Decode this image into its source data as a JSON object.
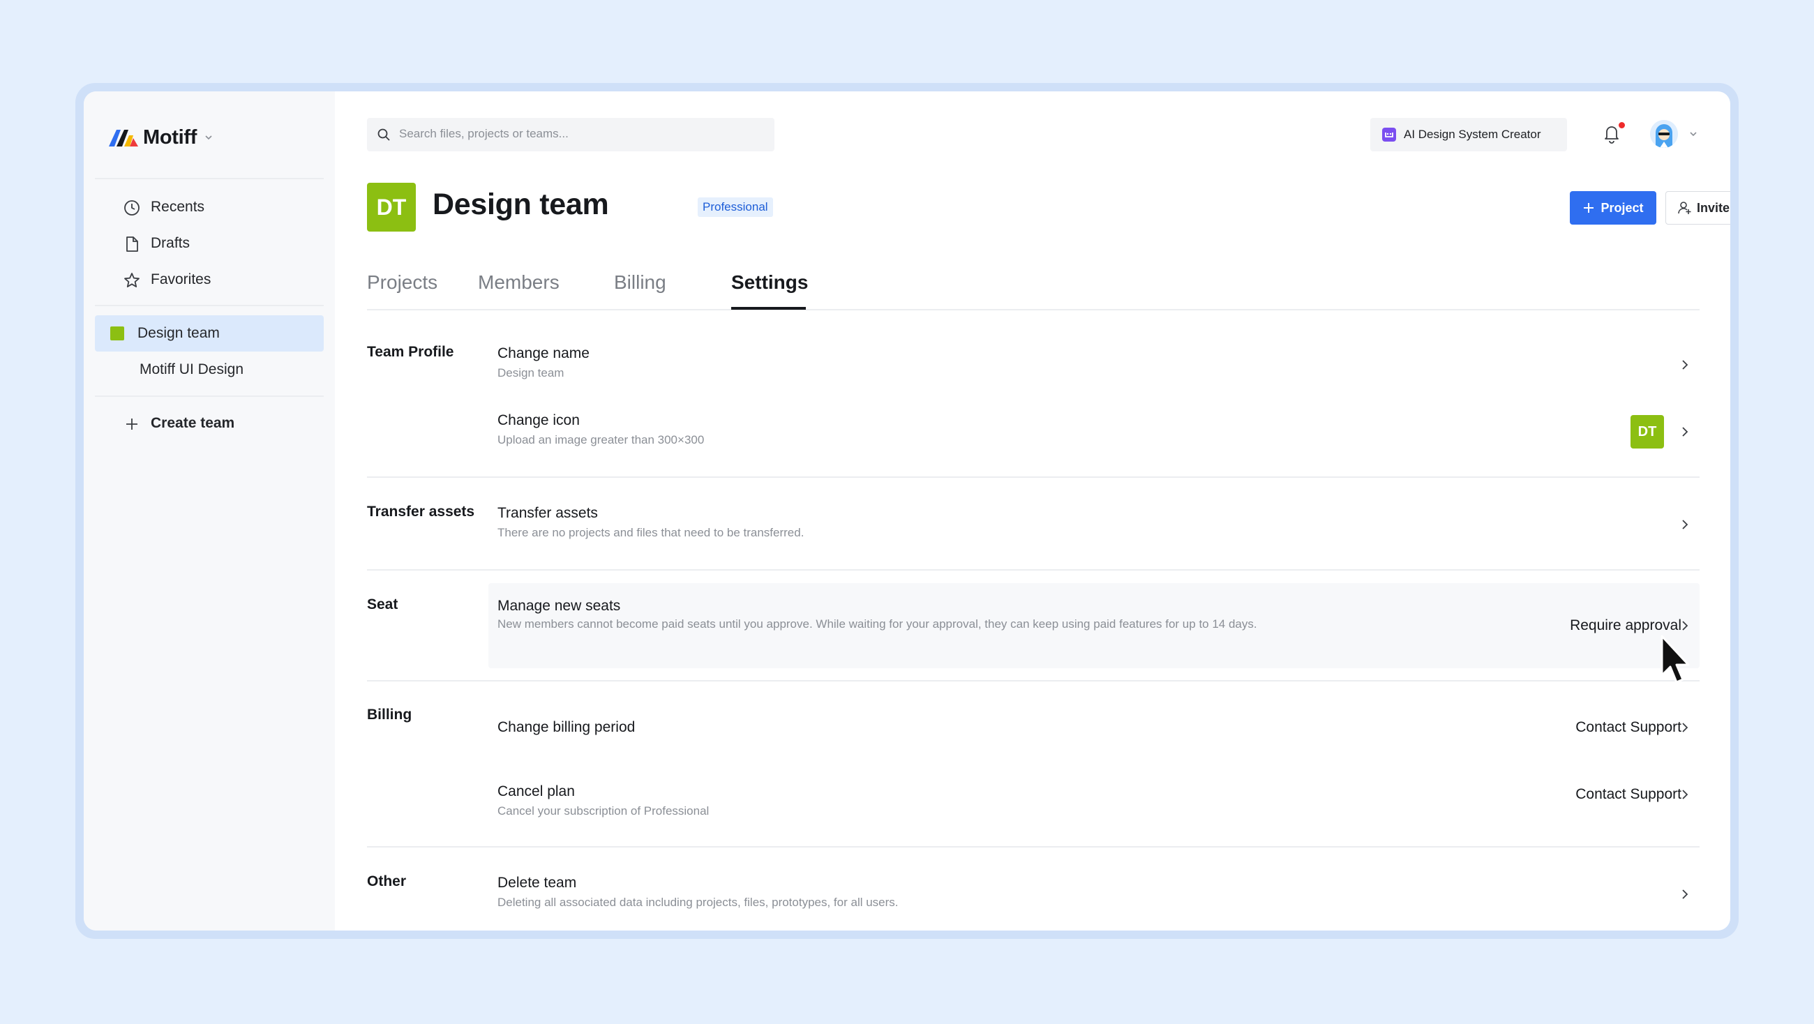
{
  "app": {
    "name": "Motiff"
  },
  "sidebar": {
    "nav": [
      {
        "label": "Recents",
        "icon": "clock-icon"
      },
      {
        "label": "Drafts",
        "icon": "file-icon"
      },
      {
        "label": "Favorites",
        "icon": "star-icon"
      }
    ],
    "teams": [
      {
        "label": "Design team",
        "active": true,
        "color": "#8cbf12"
      },
      {
        "label": "Motiff UI Design",
        "active": false
      }
    ],
    "create_team_label": "Create team"
  },
  "topbar": {
    "search_placeholder": "Search files, projects or teams...",
    "ai_button_label": "AI Design System Creator",
    "notification_dot": true
  },
  "header": {
    "team_initials": "DT",
    "team_name": "Design team",
    "plan_badge": "Professional",
    "project_button": "Project",
    "invite_button": "Invite"
  },
  "tabs": [
    {
      "label": "Projects",
      "active": false
    },
    {
      "label": "Members",
      "active": false
    },
    {
      "label": "Billing",
      "active": false
    },
    {
      "label": "Settings",
      "active": true
    }
  ],
  "settings": {
    "team_profile": {
      "label": "Team Profile",
      "rows": [
        {
          "title": "Change name",
          "desc": "Design team"
        },
        {
          "title": "Change icon",
          "desc": "Upload an image greater than 300×300",
          "icon_initials": "DT"
        }
      ]
    },
    "transfer_assets": {
      "label": "Transfer assets",
      "rows": [
        {
          "title": "Transfer assets",
          "desc": "There are no projects and files that need to be transferred."
        }
      ]
    },
    "seat": {
      "label": "Seat",
      "rows": [
        {
          "title": "Manage new seats",
          "desc": "New members cannot become paid seats until you approve. While waiting for your approval, they can keep using paid features for up to 14 days.",
          "value": "Require approval"
        }
      ]
    },
    "billing": {
      "label": "Billing",
      "rows": [
        {
          "title": "Change billing period",
          "value": "Contact Support"
        },
        {
          "title": "Cancel plan",
          "desc": "Cancel your subscription of Professional",
          "value": "Contact Support"
        }
      ]
    },
    "other": {
      "label": "Other",
      "rows": [
        {
          "title": "Delete team",
          "desc": "Deleting all associated data including projects, files, prototypes, for all users."
        }
      ]
    }
  },
  "colors": {
    "accent": "#2f6ef0",
    "team_green": "#8cbf12",
    "sidebar_active": "#dbe9fc",
    "background": "#e4effd"
  }
}
